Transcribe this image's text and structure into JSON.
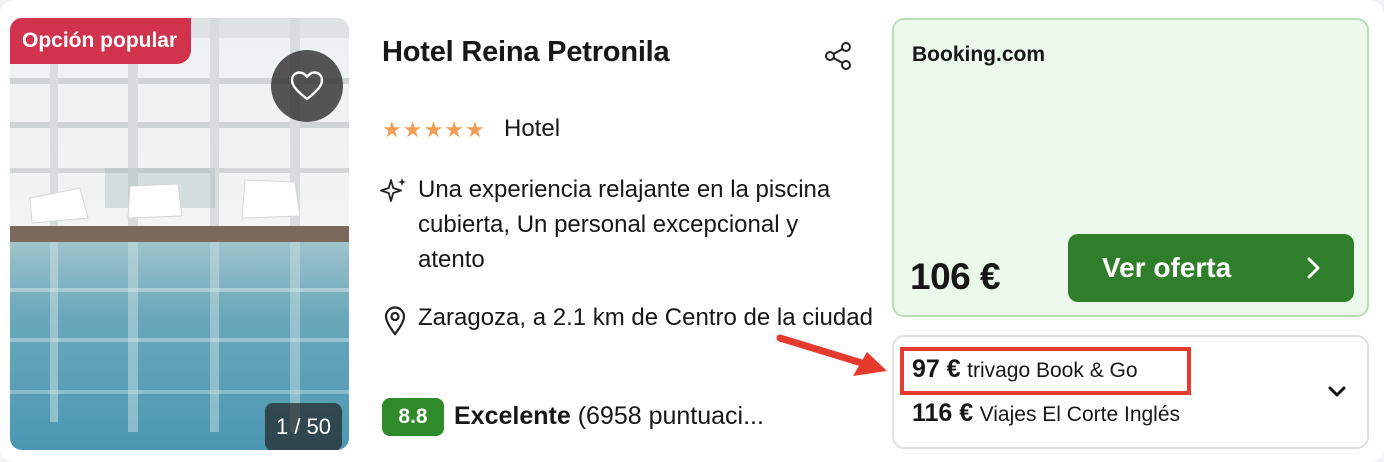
{
  "badge": {
    "label": "Opción popular"
  },
  "photo": {
    "counter": "1 / 50"
  },
  "hotel": {
    "name": "Hotel Reina Petronila",
    "stars": [
      "★",
      "★",
      "★",
      "★",
      "★"
    ],
    "type": "Hotel",
    "highlight": "Una experiencia relajante en la piscina cubierta, Un personal excepcional y atento",
    "location": "Zaragoza, a 2.1 km de Centro de la ciudad",
    "rating_score": "8.8",
    "rating_label": "Excelente",
    "rating_count": "(6958 puntuaci..."
  },
  "offer": {
    "provider": "Booking.com",
    "price": "106 €",
    "cta_label": "Ver oferta"
  },
  "alternatives": [
    {
      "price": "97 €",
      "provider": "trivago Book & Go"
    },
    {
      "price": "116 €",
      "provider": "Viajes El Corte Inglés"
    }
  ],
  "colors": {
    "badge_red": "#d1334d",
    "star_orange": "#f29f55",
    "rating_green": "#2f8a2a",
    "cta_green": "#2f7f2a",
    "offer_bg": "#ecf8ec",
    "annotation_red": "#e53a2d"
  },
  "icons": [
    "heart-icon",
    "share-icon",
    "sparkle-icon",
    "location-pin-icon",
    "chevron-right-icon",
    "chevron-down-icon",
    "arrow-annotation"
  ]
}
